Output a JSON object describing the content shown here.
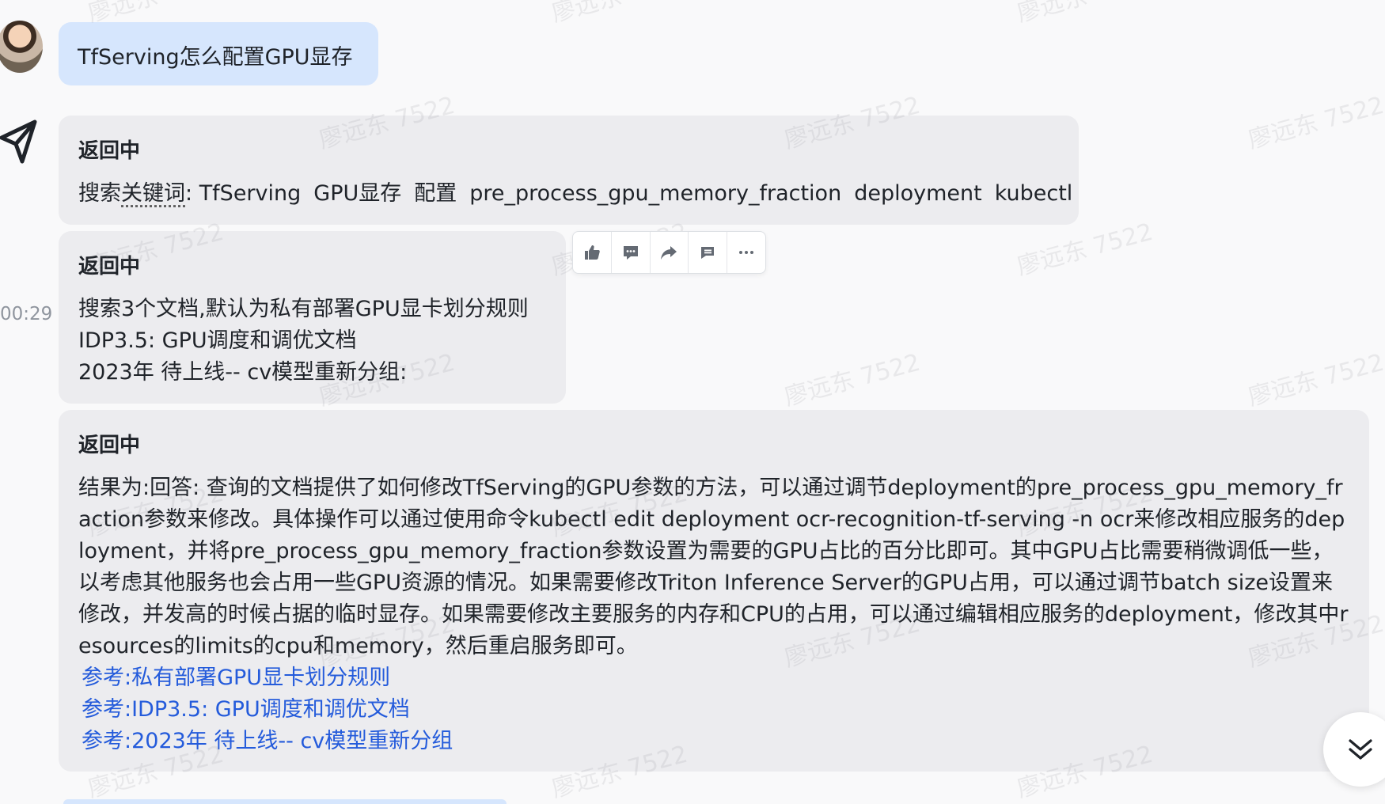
{
  "user_message": {
    "text": "TfServing怎么配置GPU显存"
  },
  "bot_messages": [
    {
      "title": "返回中",
      "keywords_label": "搜索关键词",
      "keywords": [
        "TfServing",
        "GPU显存",
        "配置",
        "pre_process_gpu_memory_fraction",
        "deployment",
        "kubectl"
      ]
    },
    {
      "title": "返回中",
      "lines": [
        "搜索3个文档,默认为私有部署GPU显卡划分规则",
        "IDP3.5: GPU调度和调优文档",
        "2023年 待上线-- cv模型重新分组:"
      ]
    },
    {
      "title": "返回中",
      "answer": "结果为:回答: 查询的文档提供了如何修改TfServing的GPU参数的方法，可以通过调节deployment的pre_process_gpu_memory_fraction参数来修改。具体操作可以通过使用命令kubectl edit deployment ocr-recognition-tf-serving -n ocr来修改相应服务的deployment，并将pre_process_gpu_memory_fraction参数设置为需要的GPU占比的百分比即可。其中GPU占比需要稍微调低一些，以考虑其他服务也会占用一些GPU资源的情况。如果需要修改Triton Inference Server的GPU占用，可以通过调节batch size设置来修改，并发高的时候占据的临时显存。如果需要修改主要服务的内存和CPU的占用，可以通过编辑相应服务的deployment，修改其中resources的limits的cpu和memory，然后重启服务即可。",
      "references": [
        "参考:私有部署GPU显卡划分规则",
        "参考:IDP3.5: GPU调度和调优文档",
        "参考:2023年 待上线-- cv模型重新分组"
      ]
    }
  ],
  "timestamp": "00:29",
  "watermark": "廖远东 7522",
  "action_bar": {
    "icons": [
      "thumbs-up-icon",
      "comment-icon",
      "forward-icon",
      "quote-icon",
      "more-icon"
    ]
  },
  "colors": {
    "user_bubble": "#d6e6fd",
    "bot_bubble": "#ececef",
    "link": "#245bdb",
    "background": "#f9f9fa"
  }
}
